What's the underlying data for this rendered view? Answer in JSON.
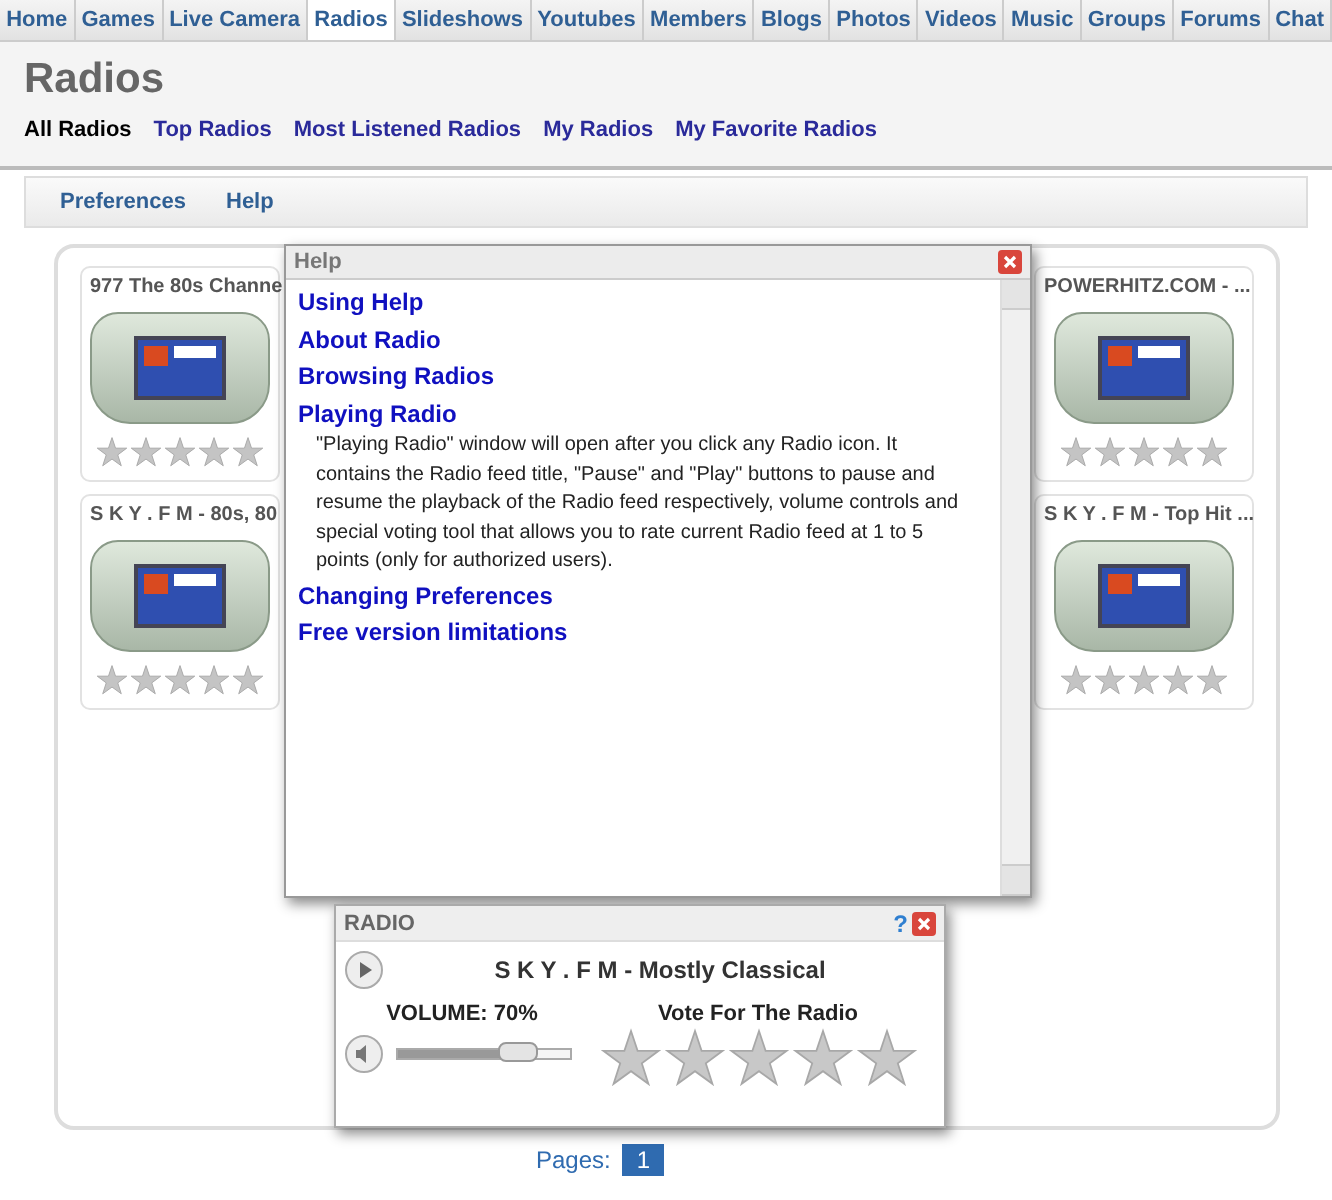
{
  "tabs": [
    {
      "label": "Home",
      "selected": false
    },
    {
      "label": "Games",
      "selected": false
    },
    {
      "label": "Live Camera",
      "selected": false
    },
    {
      "label": "Radios",
      "selected": true
    },
    {
      "label": "Slideshows",
      "selected": false
    },
    {
      "label": "Youtubes",
      "selected": false
    },
    {
      "label": "Members",
      "selected": false
    },
    {
      "label": "Blogs",
      "selected": false
    },
    {
      "label": "Photos",
      "selected": false
    },
    {
      "label": "Videos",
      "selected": false
    },
    {
      "label": "Music",
      "selected": false
    },
    {
      "label": "Groups",
      "selected": false
    },
    {
      "label": "Forums",
      "selected": false
    },
    {
      "label": "Chat",
      "selected": false
    }
  ],
  "page_title": "Radios",
  "subnav": [
    {
      "label": "All Radios",
      "selected": true
    },
    {
      "label": "Top Radios",
      "selected": false
    },
    {
      "label": "Most Listened Radios",
      "selected": false
    },
    {
      "label": "My Radios",
      "selected": false
    },
    {
      "label": "My Favorite Radios",
      "selected": false
    }
  ],
  "toolbar": [
    "Preferences",
    "Help"
  ],
  "radios": [
    {
      "title": "977 The 80s Channe",
      "stars": 0
    },
    {
      "title": "POWERHITZ.COM - ...",
      "stars": 0
    },
    {
      "title": "S K Y . F M - 80s, 80",
      "stars": 0
    },
    {
      "title": "S K Y . F M - Top Hit ...",
      "stars": 0
    }
  ],
  "help_window": {
    "title": "Help",
    "items": [
      {
        "title": "Using Help"
      },
      {
        "title": "About Radio"
      },
      {
        "title": "Browsing Radios"
      },
      {
        "title": "Playing Radio",
        "text": "\"Playing Radio\" window will open after you click any Radio icon. It contains the Radio feed title, \"Pause\" and \"Play\" buttons to pause and resume the playback of the Radio feed respectively, volume controls and special voting tool that allows you to rate current Radio feed at 1 to 5 points (only for authorized users)."
      },
      {
        "title": "Changing Preferences"
      },
      {
        "title": "Free version limitations"
      }
    ]
  },
  "radio_window": {
    "title": "RADIO",
    "help": "?",
    "station": "S K Y . F M - Mostly Classical",
    "volume_label": "VOLUME: 70%",
    "volume": {
      "level": 0.7
    },
    "vote_label": "Vote For The Radio",
    "stars": 0
  },
  "pagination": {
    "label": "Pages:",
    "pages": [
      {
        "label": "1",
        "selected": true
      }
    ]
  }
}
